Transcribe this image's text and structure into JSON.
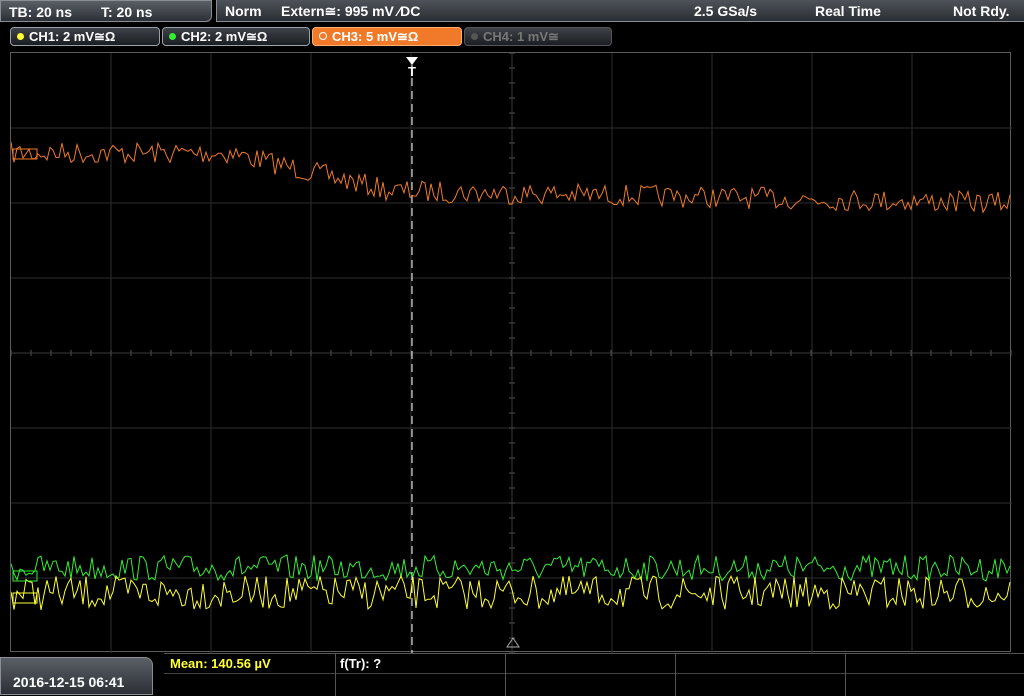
{
  "timebase": {
    "tb": "TB: 20 ns",
    "t": "T: 20 ns"
  },
  "status": {
    "mode": "Norm",
    "trigger": "Extern≅: 995 mV ⁄DC",
    "sample_rate": "2.5 GSa/s",
    "acq": "Real Time",
    "state": "Not Rdy."
  },
  "channels": [
    {
      "label": "CH1: 2 mV≅Ω",
      "color": "#ffff33",
      "state": "on"
    },
    {
      "label": "CH2: 2 mV≅Ω",
      "color": "#33ee33",
      "state": "on"
    },
    {
      "label": "CH3: 5 mV≅Ω",
      "color": "#f07a2a",
      "state": "active"
    },
    {
      "label": "CH4: 1 mV≅",
      "color": "#777777",
      "state": "off"
    }
  ],
  "trigger_marker": "T",
  "datetime": "2016-12-15 06:41",
  "measurements": {
    "mean": "Mean: 140.56 µV",
    "ftr": "f(Tr): ?"
  },
  "waveform_colors": {
    "ch1": "#ffff33",
    "ch2": "#33ee33",
    "ch3": "#f07a2a"
  }
}
